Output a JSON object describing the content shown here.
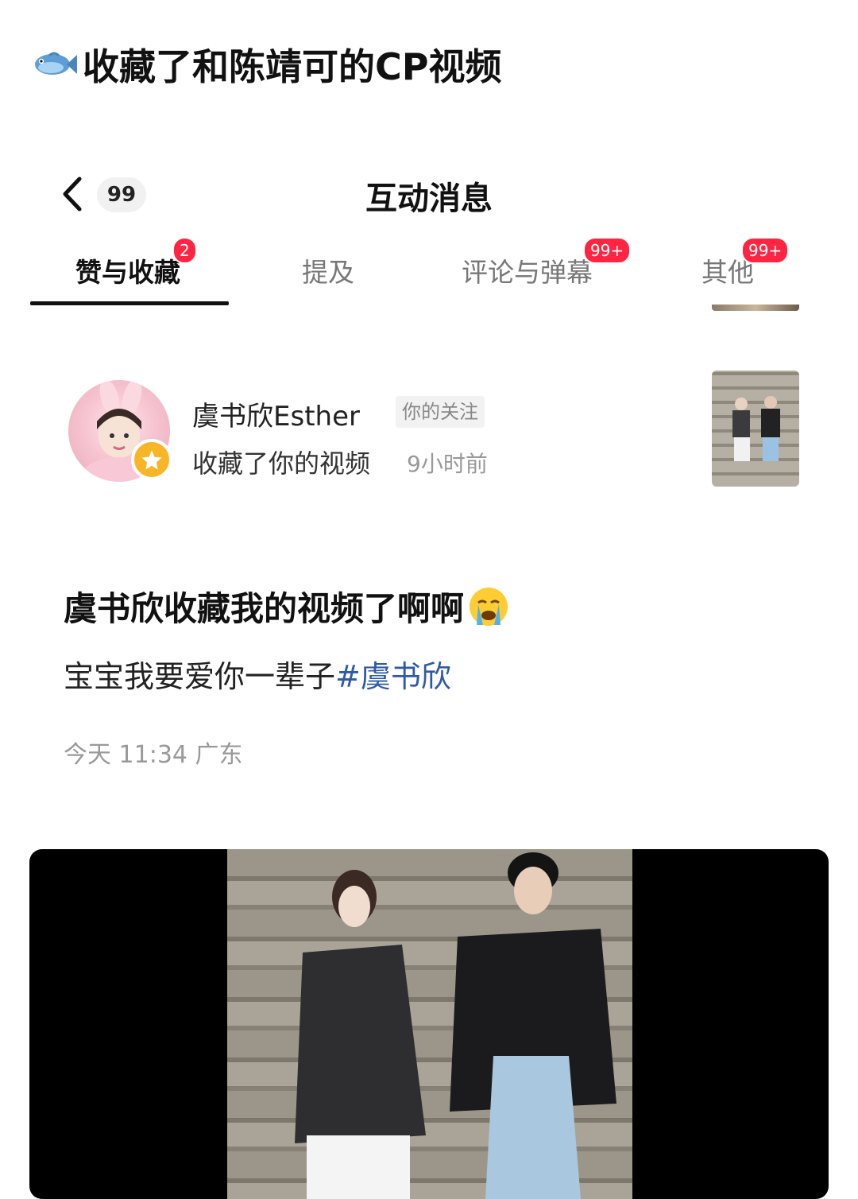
{
  "headline": "收藏了和陈靖可的CP视频",
  "nav": {
    "back_count": "99",
    "title": "互动消息"
  },
  "tabs": [
    {
      "label": "赞与收藏",
      "badge": "2",
      "active": true
    },
    {
      "label": "提及",
      "badge": "",
      "active": false
    },
    {
      "label": "评论与弹幕",
      "badge": "99+",
      "active": false
    },
    {
      "label": "其他",
      "badge": "99+",
      "active": false
    }
  ],
  "notification": {
    "name": "虞书欣Esther",
    "tag": "你的关注",
    "action": "收藏了你的视频",
    "time": "9小时前"
  },
  "post": {
    "title": "虞书欣收藏我的视频了啊啊",
    "body_text": "宝宝我要爱你一辈子",
    "hashtag": "#虞书欣",
    "meta": "今天 11:34 广东"
  },
  "colors": {
    "accent_red": "#ff2442",
    "hashtag_blue": "#2f5aa6",
    "star_yellow": "#f8b525"
  },
  "icons": [
    "fish-icon",
    "back-arrow-icon",
    "star-icon",
    "crying-face-icon"
  ]
}
